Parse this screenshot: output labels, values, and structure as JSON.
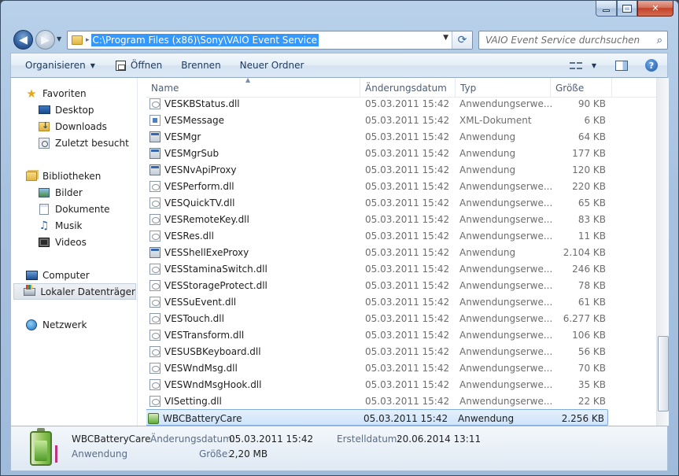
{
  "window": {
    "controls": {
      "minimize": "minimize",
      "maximize": "maximize",
      "close": "x"
    }
  },
  "navigation": {
    "address": "C:\\Program Files (x86)\\Sony\\VAIO Event Service",
    "search_placeholder": "VAIO Event Service durchsuchen"
  },
  "toolbar": {
    "organize": "Organisieren",
    "open": "Öffnen",
    "burn": "Brennen",
    "new_folder": "Neuer Ordner"
  },
  "sidebar": {
    "favorites": {
      "label": "Favoriten",
      "items": [
        {
          "label": "Desktop",
          "icon": "desktop-icon"
        },
        {
          "label": "Downloads",
          "icon": "downloads-icon"
        },
        {
          "label": "Zuletzt besucht",
          "icon": "recent-places-icon"
        }
      ]
    },
    "libraries": {
      "label": "Bibliotheken",
      "items": [
        {
          "label": "Bilder",
          "icon": "pictures-icon"
        },
        {
          "label": "Dokumente",
          "icon": "documents-icon"
        },
        {
          "label": "Musik",
          "icon": "music-icon"
        },
        {
          "label": "Videos",
          "icon": "videos-icon"
        }
      ]
    },
    "computer": {
      "label": "Computer",
      "items": [
        {
          "label": "Lokaler Datenträger",
          "icon": "local-disk-icon",
          "selected": true
        }
      ]
    },
    "network": {
      "label": "Netzwerk"
    }
  },
  "columns": {
    "name": "Name",
    "date": "Änderungsdatum",
    "type": "Typ",
    "size": "Größe"
  },
  "files": [
    {
      "name": "VESKBStatus.dll",
      "date": "05.03.2011 15:42",
      "type": "Anwendungserwe...",
      "size": "90 KB",
      "icon": "dll"
    },
    {
      "name": "VESMessage",
      "date": "05.03.2011 15:42",
      "type": "XML-Dokument",
      "size": "6 KB",
      "icon": "xml"
    },
    {
      "name": "VESMgr",
      "date": "05.03.2011 15:42",
      "type": "Anwendung",
      "size": "64 KB",
      "icon": "exe"
    },
    {
      "name": "VESMgrSub",
      "date": "05.03.2011 15:42",
      "type": "Anwendung",
      "size": "177 KB",
      "icon": "exe"
    },
    {
      "name": "VESNvApiProxy",
      "date": "05.03.2011 15:42",
      "type": "Anwendung",
      "size": "120 KB",
      "icon": "exe"
    },
    {
      "name": "VESPerform.dll",
      "date": "05.03.2011 15:42",
      "type": "Anwendungserwe...",
      "size": "220 KB",
      "icon": "dll"
    },
    {
      "name": "VESQuickTV.dll",
      "date": "05.03.2011 15:42",
      "type": "Anwendungserwe...",
      "size": "65 KB",
      "icon": "dll"
    },
    {
      "name": "VESRemoteKey.dll",
      "date": "05.03.2011 15:42",
      "type": "Anwendungserwe...",
      "size": "83 KB",
      "icon": "dll"
    },
    {
      "name": "VESRes.dll",
      "date": "05.03.2011 15:42",
      "type": "Anwendungserwe...",
      "size": "11 KB",
      "icon": "dll"
    },
    {
      "name": "VESShellExeProxy",
      "date": "05.03.2011 15:42",
      "type": "Anwendung",
      "size": "2.104 KB",
      "icon": "exe"
    },
    {
      "name": "VESStaminaSwitch.dll",
      "date": "05.03.2011 15:42",
      "type": "Anwendungserwe...",
      "size": "246 KB",
      "icon": "dll"
    },
    {
      "name": "VESStorageProtect.dll",
      "date": "05.03.2011 15:42",
      "type": "Anwendungserwe...",
      "size": "78 KB",
      "icon": "dll"
    },
    {
      "name": "VESSuEvent.dll",
      "date": "05.03.2011 15:42",
      "type": "Anwendungserwe...",
      "size": "61 KB",
      "icon": "dll"
    },
    {
      "name": "VESTouch.dll",
      "date": "05.03.2011 15:42",
      "type": "Anwendungserwe...",
      "size": "6.277 KB",
      "icon": "dll"
    },
    {
      "name": "VESTransform.dll",
      "date": "05.03.2011 15:42",
      "type": "Anwendungserwe...",
      "size": "106 KB",
      "icon": "dll"
    },
    {
      "name": "VESUSBKeyboard.dll",
      "date": "05.03.2011 15:42",
      "type": "Anwendungserwe...",
      "size": "56 KB",
      "icon": "dll"
    },
    {
      "name": "VESWndMsg.dll",
      "date": "05.03.2011 15:42",
      "type": "Anwendungserwe...",
      "size": "70 KB",
      "icon": "dll"
    },
    {
      "name": "VESWndMsgHook.dll",
      "date": "05.03.2011 15:42",
      "type": "Anwendungserwe...",
      "size": "35 KB",
      "icon": "dll"
    },
    {
      "name": "VISetting.dll",
      "date": "05.03.2011 15:42",
      "type": "Anwendungserwe...",
      "size": "22 KB",
      "icon": "dll"
    },
    {
      "name": "WBCBatteryCare",
      "date": "05.03.2011 15:42",
      "type": "Anwendung",
      "size": "2.256 KB",
      "icon": "battery",
      "selected": true
    }
  ],
  "details": {
    "name": "WBCBatteryCare",
    "type": "Anwendung",
    "modified_label": "Änderungsdatum:",
    "modified_value": "05.03.2011 15:42",
    "created_label": "Erstelldatum:",
    "created_value": "20.06.2014 13:11",
    "size_label": "Größe:",
    "size_value": "2,20 MB"
  }
}
